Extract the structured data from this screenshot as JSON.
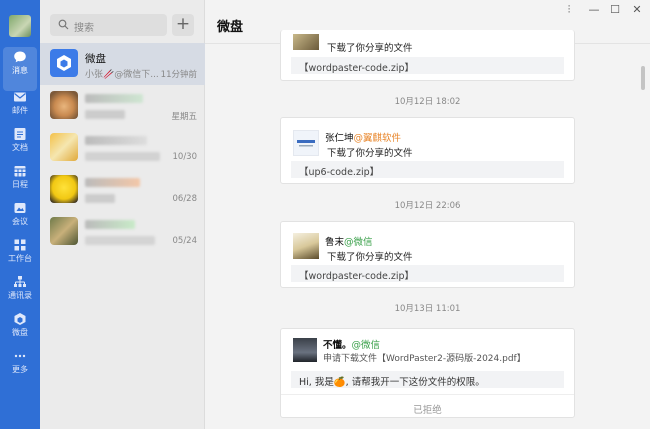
{
  "nav": {
    "items": [
      {
        "label": "消息",
        "icon": "chat-icon"
      },
      {
        "label": "邮件",
        "icon": "mail-icon"
      },
      {
        "label": "文档",
        "icon": "doc-icon"
      },
      {
        "label": "日程",
        "icon": "calendar-icon"
      },
      {
        "label": "会议",
        "icon": "meeting-icon"
      },
      {
        "label": "工作台",
        "icon": "grid-icon"
      },
      {
        "label": "通讯录",
        "icon": "contacts-icon"
      },
      {
        "label": "微盘",
        "icon": "drive-icon"
      },
      {
        "label": "更多",
        "icon": "more-icon"
      }
    ]
  },
  "search": {
    "placeholder": "搜索"
  },
  "add_label": "+",
  "conversations": [
    {
      "name": "微盘",
      "preview": "小张🥢@微信下...",
      "time": "11分钟前"
    },
    {
      "name": "",
      "preview": "",
      "time": "星期五"
    },
    {
      "name": "",
      "preview": "",
      "time": "10/30"
    },
    {
      "name": "",
      "preview": "",
      "time": "06/28"
    },
    {
      "name": "",
      "preview": "",
      "time": "05/24"
    }
  ],
  "window": {
    "title": "微盘",
    "pin": "⫶",
    "minimize": "—",
    "maximize": "☐",
    "close": "✕"
  },
  "messages": {
    "top_action": "下载了你分享的文件",
    "top_file": "【wordpaster-code.zip】",
    "t1": "10月12日 18:02",
    "m1": {
      "sender": "张仁坤",
      "corp": "@翼麒软件",
      "action": "下载了你分享的文件",
      "file": "【up6-code.zip】"
    },
    "t2": "10月12日 22:06",
    "m2": {
      "sender": "鲁末",
      "corp": "@微信",
      "action": "下载了你分享的文件",
      "file": "【wordpaster-code.zip】"
    },
    "t3": "10月13日 11:01",
    "m3": {
      "sender": "不懂。",
      "corp": "@微信",
      "action": "申请下载文件【WordPaster2-源码版-2024.pdf】",
      "note": "Hi, 我是🍊, 请帮我开一下这份文件的权限。",
      "status": "已拒绝"
    }
  }
}
